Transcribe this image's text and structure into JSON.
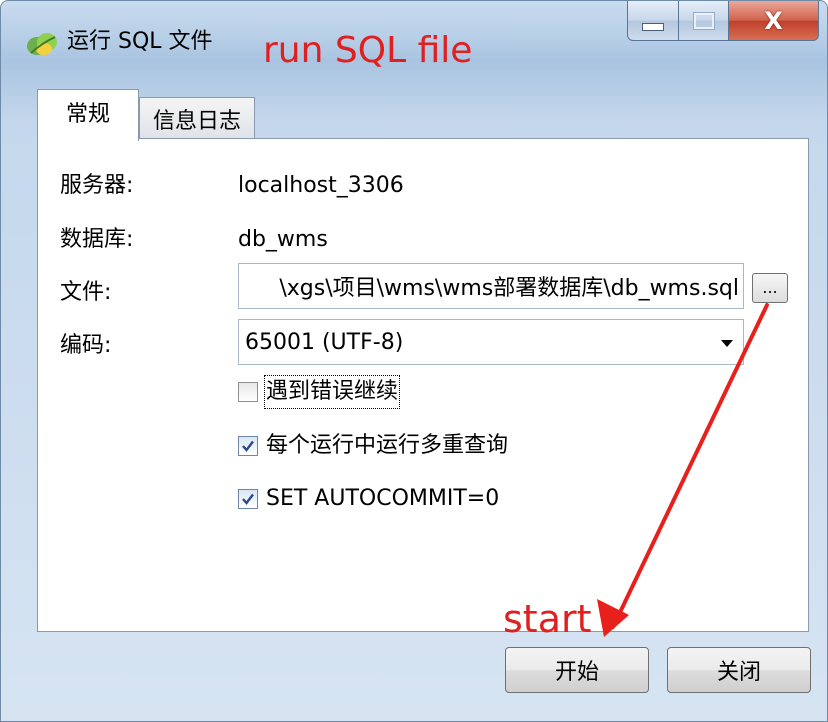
{
  "window": {
    "title": "运行 SQL 文件",
    "close_symbol": "X"
  },
  "annotations": {
    "title_note": "run SQL file",
    "start_note": "start",
    "color": "#e02020"
  },
  "tabs": [
    {
      "label": "常规",
      "active": true
    },
    {
      "label": "信息日志",
      "active": false
    }
  ],
  "form": {
    "server_label": "服务器:",
    "server_value": "localhost_3306",
    "database_label": "数据库:",
    "database_value": "db_wms",
    "file_label": "文件:",
    "file_value": "\\xgs\\项目\\wms\\wms部署数据库\\db_wms.sql",
    "browse_label": "...",
    "encoding_label": "编码:",
    "encoding_value": "65001 (UTF-8)"
  },
  "options": [
    {
      "label": "遇到错误继续",
      "checked": false
    },
    {
      "label": "每个运行中运行多重查询",
      "checked": true
    },
    {
      "label": "SET AUTOCOMMIT=0",
      "checked": true
    }
  ],
  "buttons": {
    "start": "开始",
    "close": "关闭"
  },
  "icons": {
    "app": "navicat-leaf-icon",
    "minimize": "minimize-icon",
    "maximize": "maximize-icon",
    "close": "close-icon",
    "dropdown": "chevron-down-icon",
    "check": "checkmark-icon"
  }
}
